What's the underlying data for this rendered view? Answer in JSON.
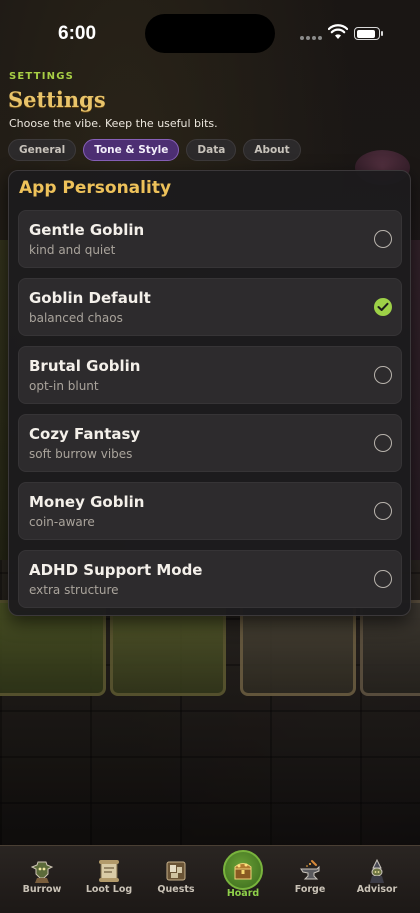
{
  "status_bar": {
    "time": "6:00",
    "signal_icon": "cellular-signal-icon",
    "wifi_icon": "wifi-icon",
    "battery_icon": "battery-icon",
    "battery_level": 0.9
  },
  "header": {
    "eyebrow": "SETTINGS",
    "title": "Settings",
    "subtitle": "Choose the vibe. Keep the useful bits."
  },
  "tabs": [
    {
      "label": "General",
      "active": false
    },
    {
      "label": "Tone & Style",
      "active": true
    },
    {
      "label": "Data",
      "active": false
    },
    {
      "label": "About",
      "active": false
    }
  ],
  "personality": {
    "title": "App Personality",
    "options": [
      {
        "name": "Gentle Goblin",
        "description": "kind and quiet",
        "selected": false
      },
      {
        "name": "Goblin Default",
        "description": "balanced chaos",
        "selected": true
      },
      {
        "name": "Brutal Goblin",
        "description": "opt-in blunt",
        "selected": false
      },
      {
        "name": "Cozy Fantasy",
        "description": "soft burrow vibes",
        "selected": false
      },
      {
        "name": "Money Goblin",
        "description": "coin-aware",
        "selected": false
      },
      {
        "name": "ADHD Support Mode",
        "description": "extra structure",
        "selected": false
      }
    ]
  },
  "tab_bar": {
    "items": [
      {
        "label": "Burrow",
        "icon": "goblin-icon",
        "active": false
      },
      {
        "label": "Loot Log",
        "icon": "scroll-icon",
        "active": false
      },
      {
        "label": "Quests",
        "icon": "quest-board-icon",
        "active": false
      },
      {
        "label": "Hoard",
        "icon": "treasure-chest-icon",
        "active": true
      },
      {
        "label": "Forge",
        "icon": "anvil-icon",
        "active": false
      },
      {
        "label": "Advisor",
        "icon": "advisor-icon",
        "active": false
      }
    ]
  },
  "colors": {
    "accent_gold": "#e9c46a",
    "accent_green": "#9dd147",
    "accent_purple": "#4d2f73"
  }
}
